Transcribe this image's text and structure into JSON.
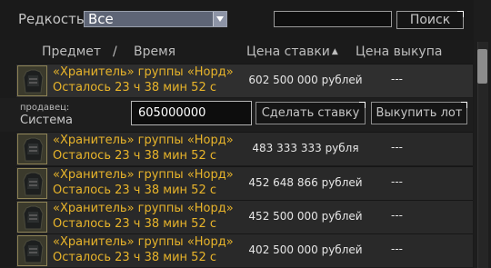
{
  "filter": {
    "rarity_label": "Редкость",
    "rarity_value": "Все"
  },
  "search": {
    "value": "",
    "button_label": "Поиск"
  },
  "columns": {
    "item": "Предмет",
    "separator": "/",
    "time": "Время",
    "bid_price": "Цена ставки",
    "sort_indicator": "▲",
    "buyout_price": "Цена выкупа"
  },
  "rows": [
    {
      "name": "«Хранитель» группы «Норд»",
      "time_left": "Осталось 23 ч 38 мин 52 с",
      "bid": "602 500 000 рублей",
      "buyout": "---",
      "icon": "armor-vest-icon"
    },
    {
      "name": "«Хранитель» группы «Норд»",
      "time_left": "Осталось 23 ч 38 мин 52 с",
      "bid": "483 333 333 рубля",
      "buyout": "---",
      "icon": "armor-vest-icon"
    },
    {
      "name": "«Хранитель» группы «Норд»",
      "time_left": "Осталось 23 ч 38 мин 52 с",
      "bid": "452 648 866 рублей",
      "buyout": "---",
      "icon": "armor-vest-icon"
    },
    {
      "name": "«Хранитель» группы «Норд»",
      "time_left": "Осталось 23 ч 38 мин 52 с",
      "bid": "452 500 000 рублей",
      "buyout": "---",
      "icon": "armor-vest-icon"
    },
    {
      "name": "«Хранитель» группы «Норд»",
      "time_left": "Осталось 23 ч 38 мин 52 с",
      "bid": "402 500 000 рублей",
      "buyout": "---",
      "icon": "armor-vest-icon"
    }
  ],
  "bid_panel": {
    "seller_label": "продавец:",
    "seller_value": "Система",
    "bid_value": "605000000",
    "bid_button": "Сделать ставку",
    "buyout_button": "Выкупить лот"
  },
  "colors": {
    "item_text": "#e8b42a",
    "background": "#1b1b1b",
    "row": "#292929"
  }
}
